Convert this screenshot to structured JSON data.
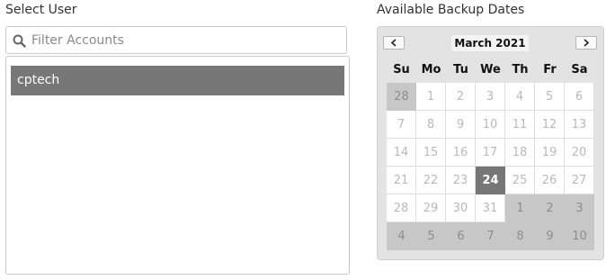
{
  "labels": {
    "select_user": "Select User",
    "available_dates": "Available Backup Dates"
  },
  "search": {
    "placeholder": "Filter Accounts",
    "icon": "search-icon"
  },
  "accounts": [
    {
      "name": "cptech",
      "selected": true
    }
  ],
  "calendar": {
    "month_title": "March 2021",
    "prev_icon": "chevron-left-icon",
    "next_icon": "chevron-right-icon",
    "weekdays": [
      "Su",
      "Mo",
      "Tu",
      "We",
      "Th",
      "Fr",
      "Sa"
    ],
    "weeks": [
      [
        "28",
        "1",
        "2",
        "3",
        "4",
        "5",
        "6"
      ],
      [
        "7",
        "8",
        "9",
        "10",
        "11",
        "12",
        "13"
      ],
      [
        "14",
        "15",
        "16",
        "17",
        "18",
        "19",
        "20"
      ],
      [
        "21",
        "22",
        "23",
        "24",
        "25",
        "26",
        "27"
      ],
      [
        "28",
        "29",
        "30",
        "31",
        "1",
        "2",
        "3"
      ],
      [
        "4",
        "5",
        "6",
        "7",
        "8",
        "9",
        "10"
      ]
    ],
    "selected_day": "24"
  },
  "colors": {
    "selection": "#777777",
    "calendar_bg": "#e3e3e3",
    "outside_day": "#c7c7c7"
  }
}
